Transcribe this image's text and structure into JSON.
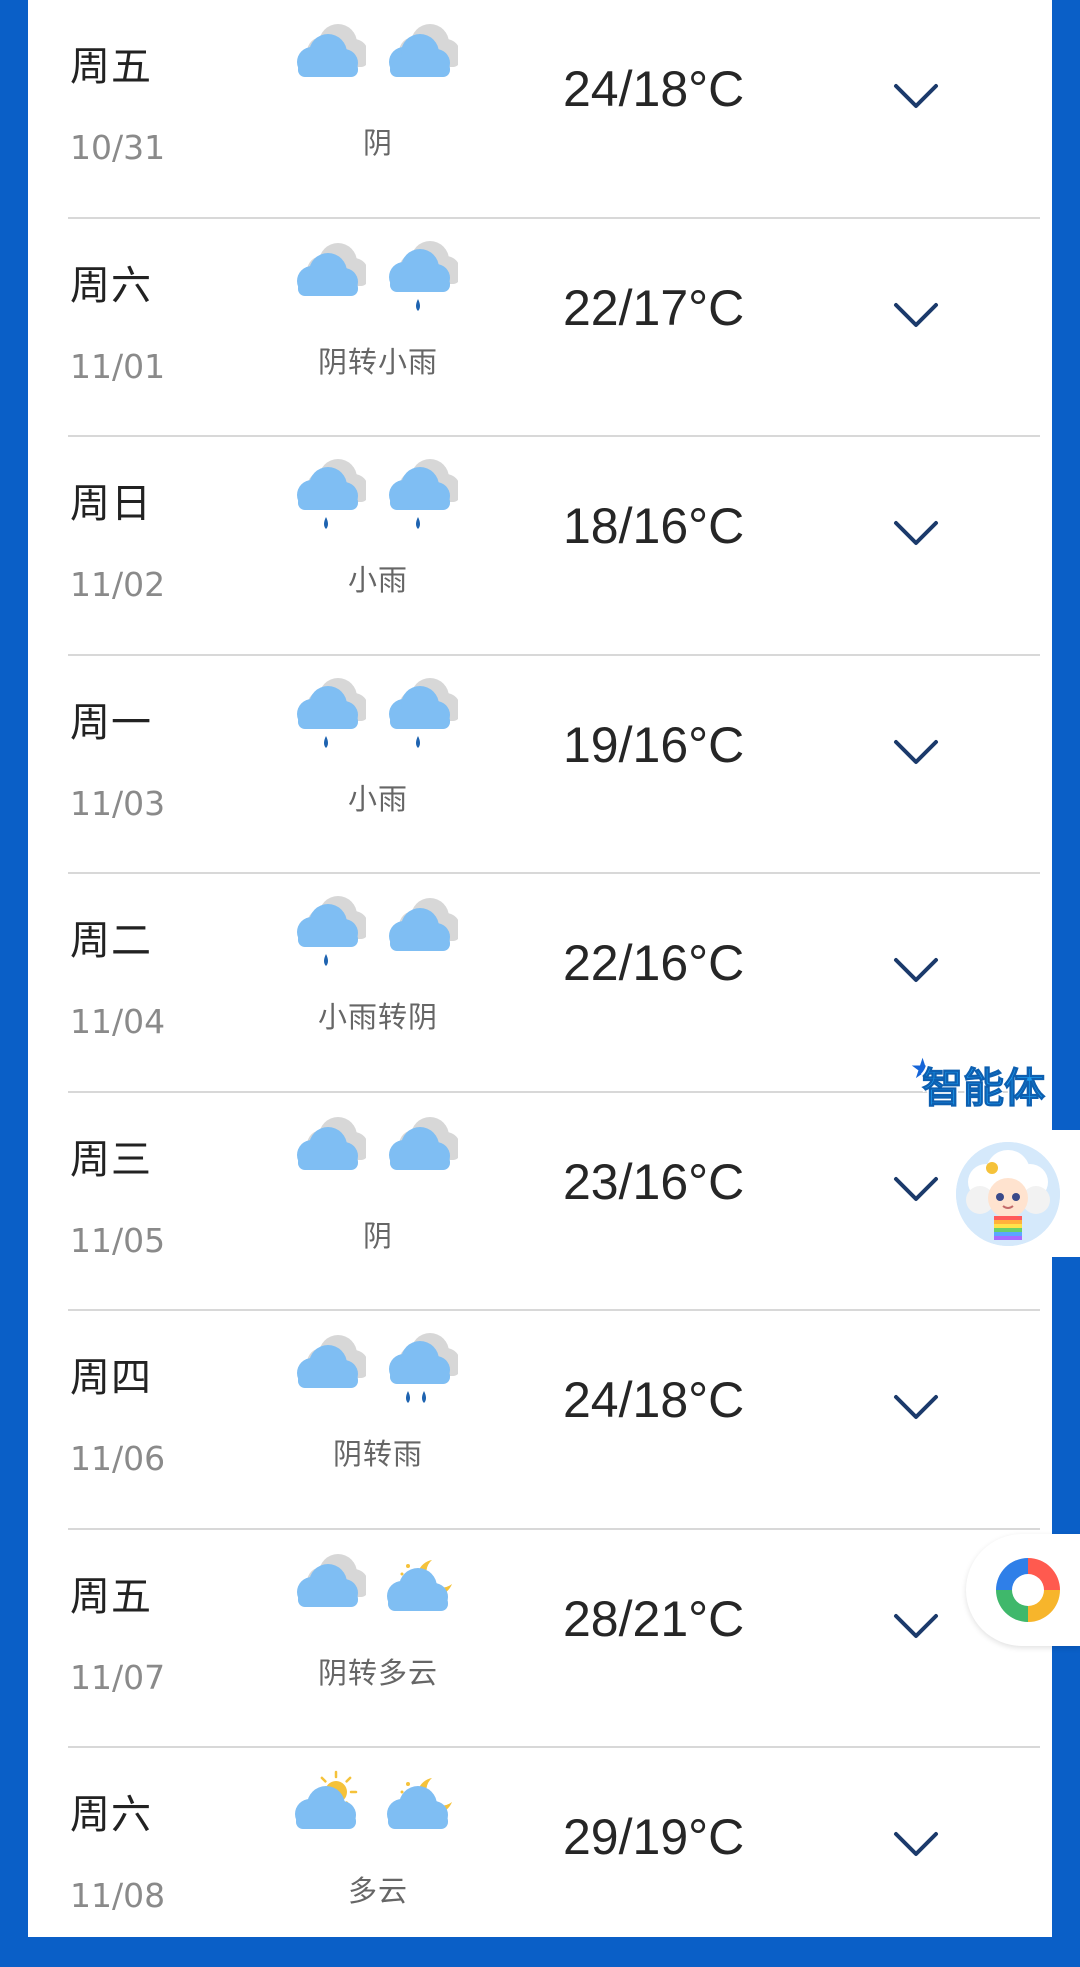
{
  "forecast": [
    {
      "weekday": "周五",
      "date": "10/31",
      "icons": [
        "cloudy",
        "cloudy"
      ],
      "condition": "阴",
      "temp": "24/18°C"
    },
    {
      "weekday": "周六",
      "date": "11/01",
      "icons": [
        "cloudy",
        "rain"
      ],
      "condition": "阴转小雨",
      "temp": "22/17°C"
    },
    {
      "weekday": "周日",
      "date": "11/02",
      "icons": [
        "rain",
        "rain"
      ],
      "condition": "小雨",
      "temp": "18/16°C"
    },
    {
      "weekday": "周一",
      "date": "11/03",
      "icons": [
        "rain",
        "rain"
      ],
      "condition": "小雨",
      "temp": "19/16°C"
    },
    {
      "weekday": "周二",
      "date": "11/04",
      "icons": [
        "rain",
        "cloudy"
      ],
      "condition": "小雨转阴",
      "temp": "22/16°C"
    },
    {
      "weekday": "周三",
      "date": "11/05",
      "icons": [
        "cloudy",
        "cloudy"
      ],
      "condition": "阴",
      "temp": "23/16°C"
    },
    {
      "weekday": "周四",
      "date": "11/06",
      "icons": [
        "cloudy",
        "rain-heavy"
      ],
      "condition": "阴转雨",
      "temp": "24/18°C"
    },
    {
      "weekday": "周五",
      "date": "11/07",
      "icons": [
        "cloudy",
        "partly-cloudy-night"
      ],
      "condition": "阴转多云",
      "temp": "28/21°C"
    },
    {
      "weekday": "周六",
      "date": "11/08",
      "icons": [
        "partly-cloudy-day",
        "partly-cloudy-night"
      ],
      "condition": "多云",
      "temp": "29/19°C"
    }
  ],
  "agent": {
    "label": "智能体",
    "icon": "star-icon"
  },
  "colors": {
    "brand_blue": "#0a5fc7",
    "chevron": "#1b3a6b",
    "cloud": "#7fbef3",
    "cloud_back": "#d7d7d7",
    "rain_drop": "#1e63b0",
    "sun": "#f5c23a"
  }
}
